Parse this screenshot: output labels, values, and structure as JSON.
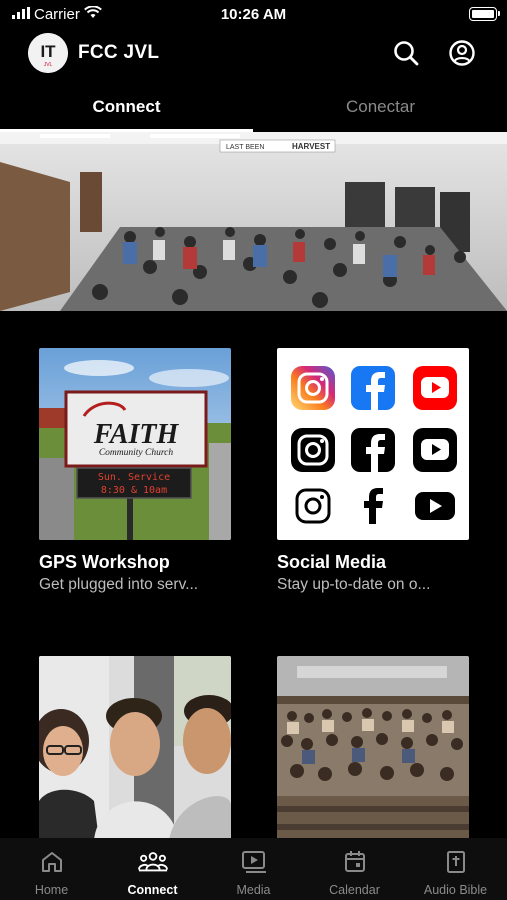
{
  "status_bar": {
    "carrier": "Carrier",
    "time": "10:26 AM"
  },
  "header": {
    "logo_text": "IT",
    "logo_subtext": "JVL",
    "title": "FCC JVL"
  },
  "tabs": [
    {
      "label": "Connect",
      "active": true
    },
    {
      "label": "Conectar",
      "active": false
    }
  ],
  "hero": {
    "banner_left": "LAST BEEN",
    "banner_right": "HARVEST"
  },
  "cards": [
    {
      "title": "GPS Workshop",
      "subtitle": "Get plugged into serv...",
      "sign_title": "FAITH",
      "sign_subtitle": "Community Church",
      "sign_led_line1": "Sun. Service",
      "sign_led_line2": "8:30 & 10am"
    },
    {
      "title": "Social Media",
      "subtitle": "Stay up-to-date on o..."
    },
    {
      "title": "",
      "subtitle": ""
    },
    {
      "title": "",
      "subtitle": ""
    }
  ],
  "nav": [
    {
      "label": "Home",
      "icon": "home-icon",
      "active": false
    },
    {
      "label": "Connect",
      "icon": "people-icon",
      "active": true
    },
    {
      "label": "Media",
      "icon": "media-icon",
      "active": false
    },
    {
      "label": "Calendar",
      "icon": "calendar-icon",
      "active": false
    },
    {
      "label": "Audio Bible",
      "icon": "bible-icon",
      "active": false
    }
  ],
  "colors": {
    "background": "#000000",
    "accent_red": "#c8102e",
    "instagram_gradient_start": "#feda75",
    "instagram_gradient_end": "#833ab4",
    "facebook_blue": "#1877f2",
    "youtube_red": "#ff0000"
  }
}
